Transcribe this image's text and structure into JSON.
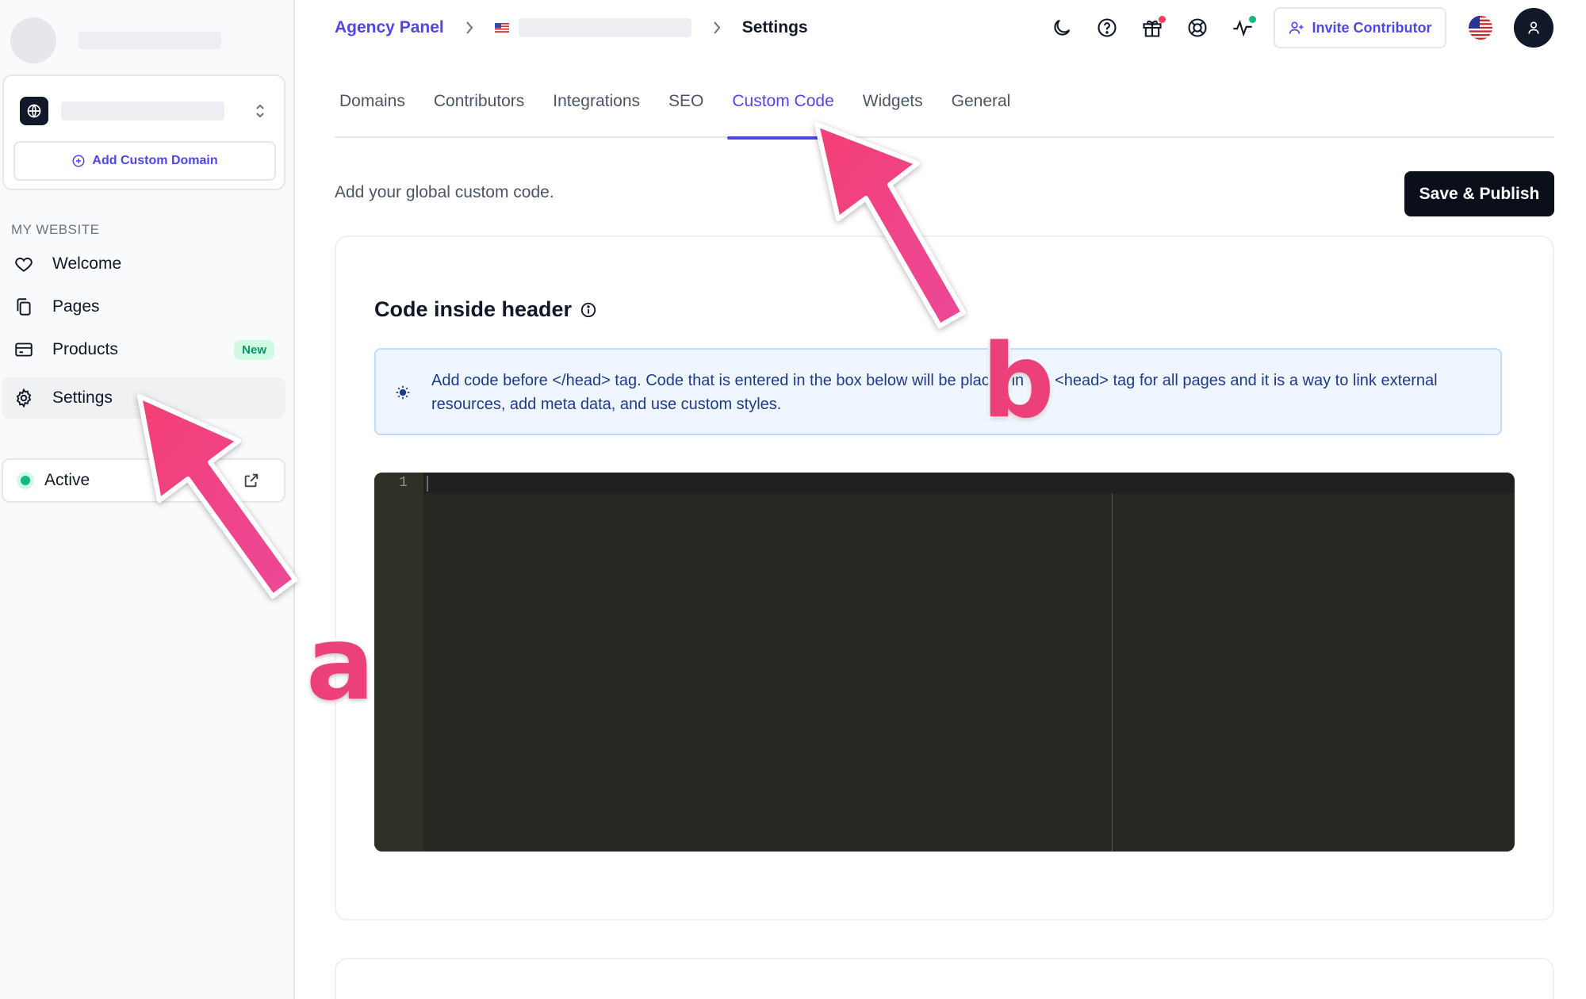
{
  "sidebar": {
    "add_domain_label": "Add Custom Domain",
    "section_label": "MY WEBSITE",
    "items": [
      {
        "label": "Welcome",
        "icon": "heart-icon"
      },
      {
        "label": "Pages",
        "icon": "pages-icon"
      },
      {
        "label": "Products",
        "icon": "credit-card-icon",
        "badge": "New"
      },
      {
        "label": "Settings",
        "icon": "gear-icon",
        "active": true
      }
    ],
    "status_label": "Active",
    "status_color": "#10b981"
  },
  "header": {
    "breadcrumb": {
      "root": "Agency Panel",
      "current": "Settings"
    },
    "invite_label": "Invite Contributor",
    "notification_colors": {
      "gift": "#f43f5e",
      "activity": "#10b981"
    }
  },
  "tabs": [
    {
      "label": "Domains"
    },
    {
      "label": "Contributors"
    },
    {
      "label": "Integrations"
    },
    {
      "label": "SEO"
    },
    {
      "label": "Custom Code",
      "active": true
    },
    {
      "label": "Widgets"
    },
    {
      "label": "General"
    }
  ],
  "main": {
    "subtitle": "Add your global custom code.",
    "publish_label": "Save & Publish",
    "section_title": "Code inside header",
    "info_text": "Add code before </head> tag. Code that is entered in the box below will be placed in the <head> tag for all pages and it is a way to link external resources, add meta data, and use custom styles.",
    "editor": {
      "line_numbers": [
        "1"
      ],
      "content": ""
    }
  },
  "annotations": [
    {
      "letter": "a",
      "target": "Settings"
    },
    {
      "letter": "b",
      "target": "Custom Code"
    }
  ],
  "colors": {
    "accent": "#4f46e5",
    "annotation": "#ec407a",
    "editor_bg": "#272822"
  }
}
